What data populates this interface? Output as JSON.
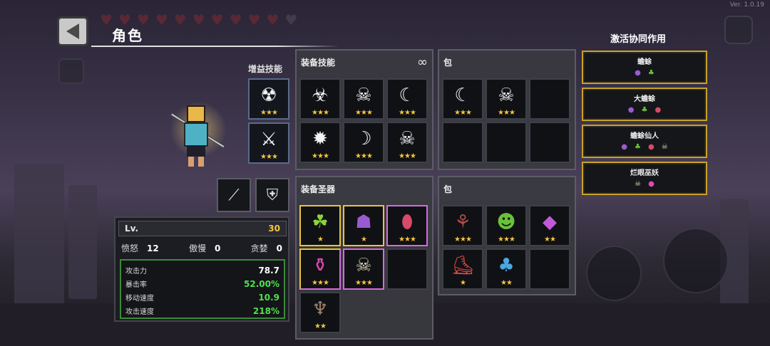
{
  "version": "Ver. 1.0.19",
  "header": {
    "title": "角色",
    "hearts_full": 10,
    "hearts_empty": 1
  },
  "buff_skills_label": "增益技能",
  "buff_skills": [
    {
      "icon": "horned-skull-icon",
      "glyph": "☢",
      "stars": "★★★"
    },
    {
      "icon": "sword-slash-icon",
      "glyph": "⚔",
      "stars": "★★★"
    }
  ],
  "weapons": [
    {
      "icon": "spear-icon",
      "glyph": "⟋"
    },
    {
      "icon": "shield-emblem-icon",
      "glyph": "⛨"
    }
  ],
  "stats": {
    "level_label": "Lv.",
    "level_value": "30",
    "attrs": [
      {
        "label": "愤怒",
        "value": "12"
      },
      {
        "label": "傲慢",
        "value": "0"
      },
      {
        "label": "贪婪",
        "value": "0"
      }
    ],
    "combat": [
      {
        "label": "攻击力",
        "value": "78.7",
        "green": false
      },
      {
        "label": "暴击率",
        "value": "52.00%",
        "green": true
      },
      {
        "label": "移动速度",
        "value": "10.9",
        "green": true
      },
      {
        "label": "攻击速度",
        "value": "218%",
        "green": true
      }
    ]
  },
  "equip_skills": {
    "title": "装备技能",
    "link_icon": "link-icon",
    "slots": [
      {
        "icon": "biohazard-icon",
        "glyph": "☣",
        "stars": "★★★"
      },
      {
        "icon": "skull-burst-icon",
        "glyph": "☠",
        "stars": "★★★"
      },
      {
        "icon": "scythe-icon",
        "glyph": "☾",
        "stars": "★★★"
      },
      {
        "icon": "star-burst-icon",
        "glyph": "✹",
        "stars": "★★★"
      },
      {
        "icon": "crescent-icon",
        "glyph": "☽",
        "stars": "★★★"
      },
      {
        "icon": "skull-dash-icon",
        "glyph": "☠",
        "stars": "★★★"
      }
    ]
  },
  "skill_bag": {
    "title": "包",
    "slots": [
      {
        "icon": "scythe-icon",
        "glyph": "☾",
        "stars": "★★★"
      },
      {
        "icon": "skull-dash-icon",
        "glyph": "☠",
        "stars": "★★★"
      },
      {
        "icon": "",
        "glyph": "",
        "stars": ""
      },
      {
        "icon": "",
        "glyph": "",
        "stars": ""
      },
      {
        "icon": "",
        "glyph": "",
        "stars": ""
      },
      {
        "icon": "",
        "glyph": "",
        "stars": ""
      }
    ]
  },
  "equip_relics": {
    "title": "装备圣器",
    "slots": [
      {
        "icon": "green-slime-icon",
        "glyph": "☘",
        "stars": "★",
        "color": "#8ad43a"
      },
      {
        "icon": "purple-hood-icon",
        "glyph": "☗",
        "stars": "★",
        "color": "#9b5bd0"
      },
      {
        "icon": "red-gem-icon",
        "glyph": "⬮",
        "stars": "★★★",
        "color": "#d84a6a"
      },
      {
        "icon": "pink-potion-icon",
        "glyph": "⚱",
        "stars": "★★★",
        "color": "#e04ab0"
      },
      {
        "icon": "skull-mask-icon",
        "glyph": "☠",
        "stars": "★★★",
        "color": "#d8d0b0"
      },
      {
        "icon": "",
        "glyph": "",
        "stars": "",
        "color": ""
      },
      {
        "icon": "twig-doll-icon",
        "glyph": "♆",
        "stars": "★★",
        "color": "#a0826a"
      }
    ]
  },
  "relic_bag": {
    "title": "包",
    "slots": [
      {
        "icon": "thorn-leaf-icon",
        "glyph": "⚘",
        "stars": "★★★",
        "color": "#b04a4a"
      },
      {
        "icon": "green-mask-icon",
        "glyph": "☻",
        "stars": "★★★",
        "color": "#6ac23a"
      },
      {
        "icon": "crystal-icon",
        "glyph": "◆",
        "stars": "★★",
        "color": "#c05ad8"
      },
      {
        "icon": "red-boot-icon",
        "glyph": "⛸",
        "stars": "★",
        "color": "#e04a4a"
      },
      {
        "icon": "blue-mushroom-icon",
        "glyph": "♣",
        "stars": "★★",
        "color": "#4aa8e0"
      },
      {
        "icon": "",
        "glyph": "",
        "stars": "",
        "color": ""
      }
    ]
  },
  "synergy": {
    "title": "激活协同作用",
    "cards": [
      {
        "name": "蟾蜍",
        "icons": [
          {
            "glyph": "●",
            "color": "#9b5bd0"
          },
          {
            "glyph": "♣",
            "color": "#6ac23a"
          }
        ]
      },
      {
        "name": "大蟾蜍",
        "icons": [
          {
            "glyph": "●",
            "color": "#9b5bd0"
          },
          {
            "glyph": "♣",
            "color": "#6ac23a"
          },
          {
            "glyph": "●",
            "color": "#d84a6a"
          }
        ]
      },
      {
        "name": "蟾蜍仙人",
        "icons": [
          {
            "glyph": "●",
            "color": "#9b5bd0"
          },
          {
            "glyph": "♣",
            "color": "#6ac23a"
          },
          {
            "glyph": "●",
            "color": "#d84a6a"
          },
          {
            "glyph": "☠",
            "color": "#d8d0b0"
          }
        ]
      },
      {
        "name": "烂眼巫妖",
        "icons": [
          {
            "glyph": "☠",
            "color": "#d8d0b0"
          },
          {
            "glyph": "●",
            "color": "#e04ab0"
          }
        ]
      }
    ]
  }
}
